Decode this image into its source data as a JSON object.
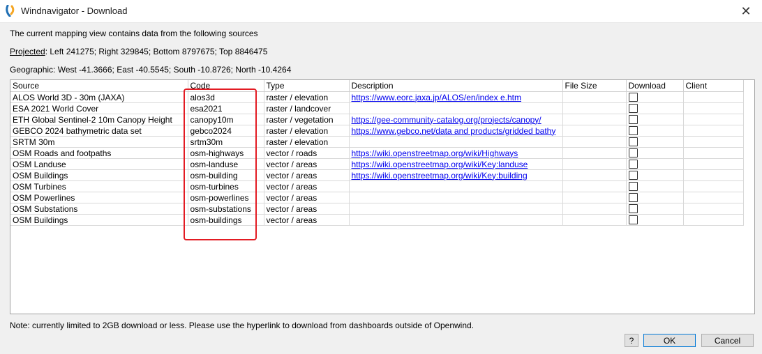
{
  "window": {
    "title": "Windnavigator - Download",
    "close_glyph": "✕"
  },
  "info": {
    "intro": "The current mapping view contains data from the following sources",
    "projected_label": "Projected",
    "projected_rest": ": Left 241275; Right 329845; Bottom 8797675; Top 8846475",
    "geographic": "Geographic: West -41.3666; East -40.5545; South -10.8726; North -10.4264"
  },
  "table": {
    "columns": [
      "Source",
      "Code",
      "Type",
      "Description",
      "File Size",
      "Download",
      "Client"
    ],
    "rows": [
      {
        "source": "ALOS World 3D - 30m (JAXA)",
        "code": "alos3d",
        "type": "raster / elevation",
        "description": "https://www.eorc.jaxa.jp/ALOS/en/index e.htm",
        "file_size": "",
        "client": ""
      },
      {
        "source": "ESA 2021 World Cover",
        "code": "esa2021",
        "type": "raster / landcover",
        "description": "",
        "file_size": "",
        "client": ""
      },
      {
        "source": "ETH Global Sentinel-2 10m Canopy Height",
        "code": "canopy10m",
        "type": "raster / vegetation",
        "description": "https://gee-community-catalog.org/projects/canopy/",
        "file_size": "",
        "client": ""
      },
      {
        "source": "GEBCO 2024 bathymetric data set",
        "code": "gebco2024",
        "type": "raster / elevation",
        "description": "https://www.gebco.net/data and products/gridded bathy",
        "file_size": "",
        "client": ""
      },
      {
        "source": "SRTM 30m",
        "code": "srtm30m",
        "type": "raster / elevation",
        "description": "",
        "file_size": "",
        "client": ""
      },
      {
        "source": "OSM Roads and footpaths",
        "code": "osm-highways",
        "type": "vector / roads",
        "description": "https://wiki.openstreetmap.org/wiki/Highways",
        "file_size": "",
        "client": ""
      },
      {
        "source": "OSM Landuse",
        "code": "osm-landuse",
        "type": "vector / areas",
        "description": "https://wiki.openstreetmap.org/wiki/Key:landuse",
        "file_size": "",
        "client": ""
      },
      {
        "source": "OSM Buildings",
        "code": "osm-building",
        "type": "vector / areas",
        "description": "https://wiki.openstreetmap.org/wiki/Key:building",
        "file_size": "",
        "client": ""
      },
      {
        "source": "OSM Turbines",
        "code": "osm-turbines",
        "type": "vector / areas",
        "description": "",
        "file_size": "",
        "client": ""
      },
      {
        "source": "OSM Powerlines",
        "code": "osm-powerlines",
        "type": "vector / areas",
        "description": "",
        "file_size": "",
        "client": ""
      },
      {
        "source": "OSM Substations",
        "code": "osm-substations",
        "type": "vector / areas",
        "description": "",
        "file_size": "",
        "client": ""
      },
      {
        "source": "OSM Buildings",
        "code": "osm-buildings",
        "type": "vector / areas",
        "description": "",
        "file_size": "",
        "client": ""
      }
    ]
  },
  "note": "Note: currently limited to 2GB download or less. Please use the hyperlink to download from dashboards outside of Openwind.",
  "buttons": {
    "help": "?",
    "ok": "OK",
    "cancel": "Cancel"
  },
  "colors": {
    "highlight": "#e31b23",
    "link": "#0000ee",
    "accent": "#0078d7"
  },
  "icons": {
    "app": "windnavigator-app-icon",
    "close": "close-icon"
  }
}
